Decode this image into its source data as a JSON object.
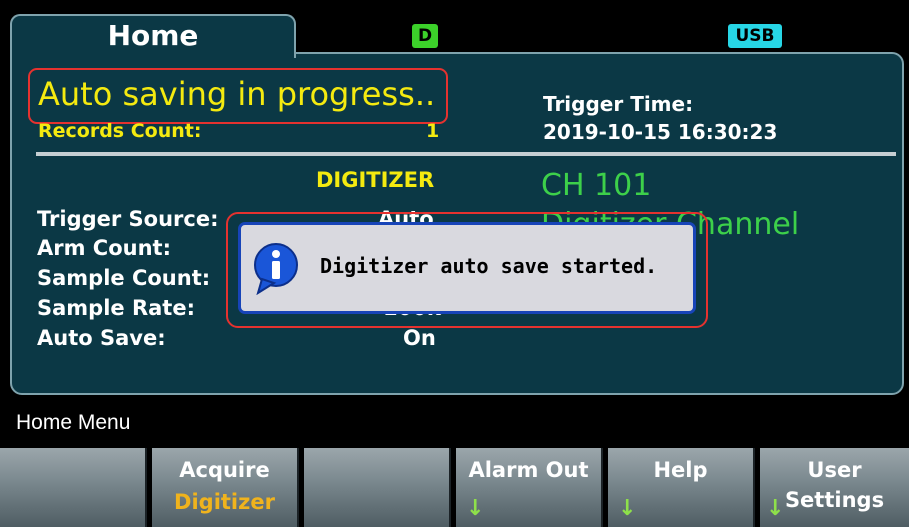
{
  "header": {
    "tab_home": "Home",
    "badge_d": "D",
    "badge_usb": "USB"
  },
  "status": {
    "title": "Auto saving in progress..",
    "records_label": "Records Count:",
    "records_value": "1",
    "trigger_time_label": "Trigger Time:",
    "trigger_time_value": "2019-10-15   16:30:23"
  },
  "mode": "DIGITIZER",
  "channel": {
    "number": "CH 101",
    "name": "Digitizer Channel"
  },
  "settings": [
    {
      "label": "Trigger Source:",
      "value": "Auto"
    },
    {
      "label": "Arm Count:",
      "value": ""
    },
    {
      "label": "Sample Count:",
      "value": ""
    },
    {
      "label": "Sample Rate:",
      "value": "100k"
    },
    {
      "label": "Auto Save:",
      "value": "On"
    }
  ],
  "popup": {
    "message": "Digitizer auto save started."
  },
  "menu": {
    "title": "Home Menu",
    "softkeys": [
      {
        "label": "",
        "sub": ""
      },
      {
        "label": "Acquire",
        "sub": "Digitizer"
      },
      {
        "label": "",
        "sub": ""
      },
      {
        "label": "Alarm Out",
        "sub": ""
      },
      {
        "label": "Help",
        "sub": ""
      },
      {
        "label": "User",
        "sub": "Settings"
      }
    ]
  },
  "colors": {
    "panel": "#0b3845",
    "status_yellow": "#f4ea10",
    "channel_green": "#3dd04a",
    "highlight_red": "#e5322f",
    "popup_border": "#1744b8"
  }
}
